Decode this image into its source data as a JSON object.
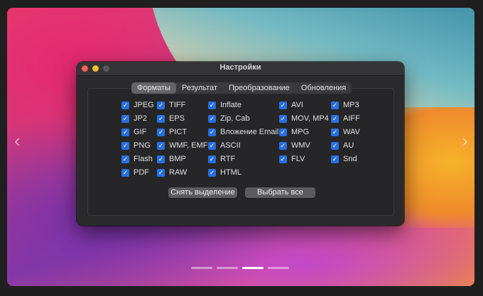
{
  "window": {
    "title": "Настройки"
  },
  "tabs": [
    "Форматы",
    "Результат",
    "Преобразование",
    "Обновления"
  ],
  "active_tab": "Форматы",
  "columns": [
    [
      "JPEG",
      "JP2",
      "GIF",
      "PNG",
      "Flash",
      "PDF"
    ],
    [
      "TIFF",
      "EPS",
      "PICT",
      "WMF, EMF",
      "BMP",
      "RAW"
    ],
    [
      "Inflate",
      "Zip, Cab",
      "Вложение Email",
      "ASCII",
      "RTF",
      "HTML"
    ],
    [
      "AVI",
      "MOV, MP4",
      "MPG",
      "WMV",
      "FLV"
    ],
    [
      "MP3",
      "AIFF",
      "WAV",
      "AU",
      "Snd"
    ]
  ],
  "check_glyph": "✓",
  "buttons": {
    "deselect": "Снять выделение",
    "select_all": "Выбрать все"
  },
  "nav": {
    "prev": "‹",
    "next": "›"
  },
  "colors": {
    "checkbox": "#2a6fe0",
    "window_bg": "#2a2a2c"
  }
}
